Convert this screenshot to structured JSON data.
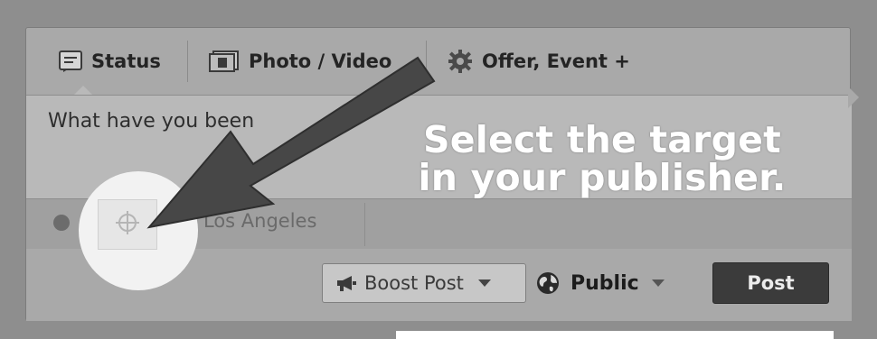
{
  "tabs": [
    {
      "label": "Status"
    },
    {
      "label": "Photo / Video"
    },
    {
      "label": "Offer, Event +"
    }
  ],
  "composer": {
    "placeholder": "What have you been"
  },
  "meta": {
    "location": "Los Angeles"
  },
  "actions": {
    "boost_label": "Boost Post",
    "privacy_label": "Public",
    "post_label": "Post"
  },
  "annotation": {
    "line1": "Select the target",
    "line2": "in your publisher."
  },
  "colors": {
    "background": "#8e8e8e",
    "publisher": "#a9a9a9",
    "composer": "#b9b9b9",
    "arrow": "#474747",
    "post_button": "#3b3b3b",
    "spotlight": "#f2f2f2"
  },
  "icons": [
    "status-icon",
    "photo-video-icon",
    "gear-icon",
    "info-icon",
    "target-icon",
    "location-pin-icon",
    "megaphone-icon",
    "globe-icon",
    "chevron-down-icon"
  ]
}
